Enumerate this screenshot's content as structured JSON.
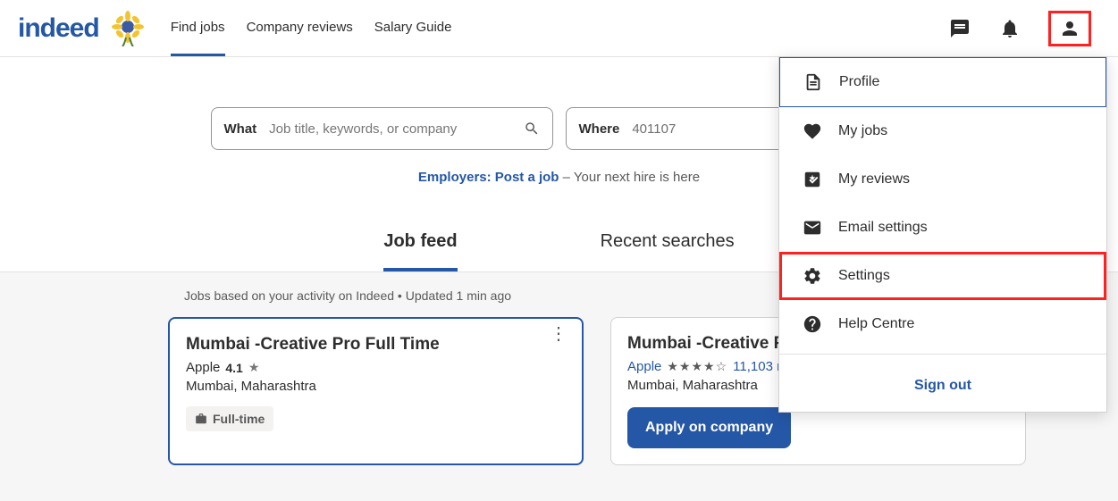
{
  "header": {
    "logo_text": "indeed",
    "nav": [
      "Find jobs",
      "Company reviews",
      "Salary Guide"
    ],
    "active_nav_index": 0
  },
  "search": {
    "what_label": "What",
    "what_placeholder": "Job title, keywords, or company",
    "where_label": "Where",
    "where_value": "401107"
  },
  "employers": {
    "link_text": "Employers: Post a job",
    "rest_text": " – Your next hire is here"
  },
  "tabs": {
    "items": [
      "Job feed",
      "Recent searches"
    ],
    "active_index": 0
  },
  "meta_text": "Jobs based on your activity on Indeed • Updated 1 min ago",
  "cards": [
    {
      "title": "Mumbai -Creative Pro Full Time",
      "company": "Apple",
      "rating": "4.1",
      "location": "Mumbai, Maharashtra",
      "tag": "Full-time",
      "selected": true
    },
    {
      "title": "Mumbai -Creative P",
      "company": "Apple",
      "reviews": "11,103 re",
      "location": "Mumbai, Maharashtra",
      "button": "Apply on company"
    }
  ],
  "dropdown": {
    "items": [
      {
        "label": "Profile",
        "icon": "doc"
      },
      {
        "label": "My jobs",
        "icon": "heart"
      },
      {
        "label": "My reviews",
        "icon": "badge"
      },
      {
        "label": "Email settings",
        "icon": "mail"
      },
      {
        "label": "Settings",
        "icon": "gear"
      },
      {
        "label": "Help Centre",
        "icon": "help"
      }
    ],
    "signout": "Sign out"
  }
}
